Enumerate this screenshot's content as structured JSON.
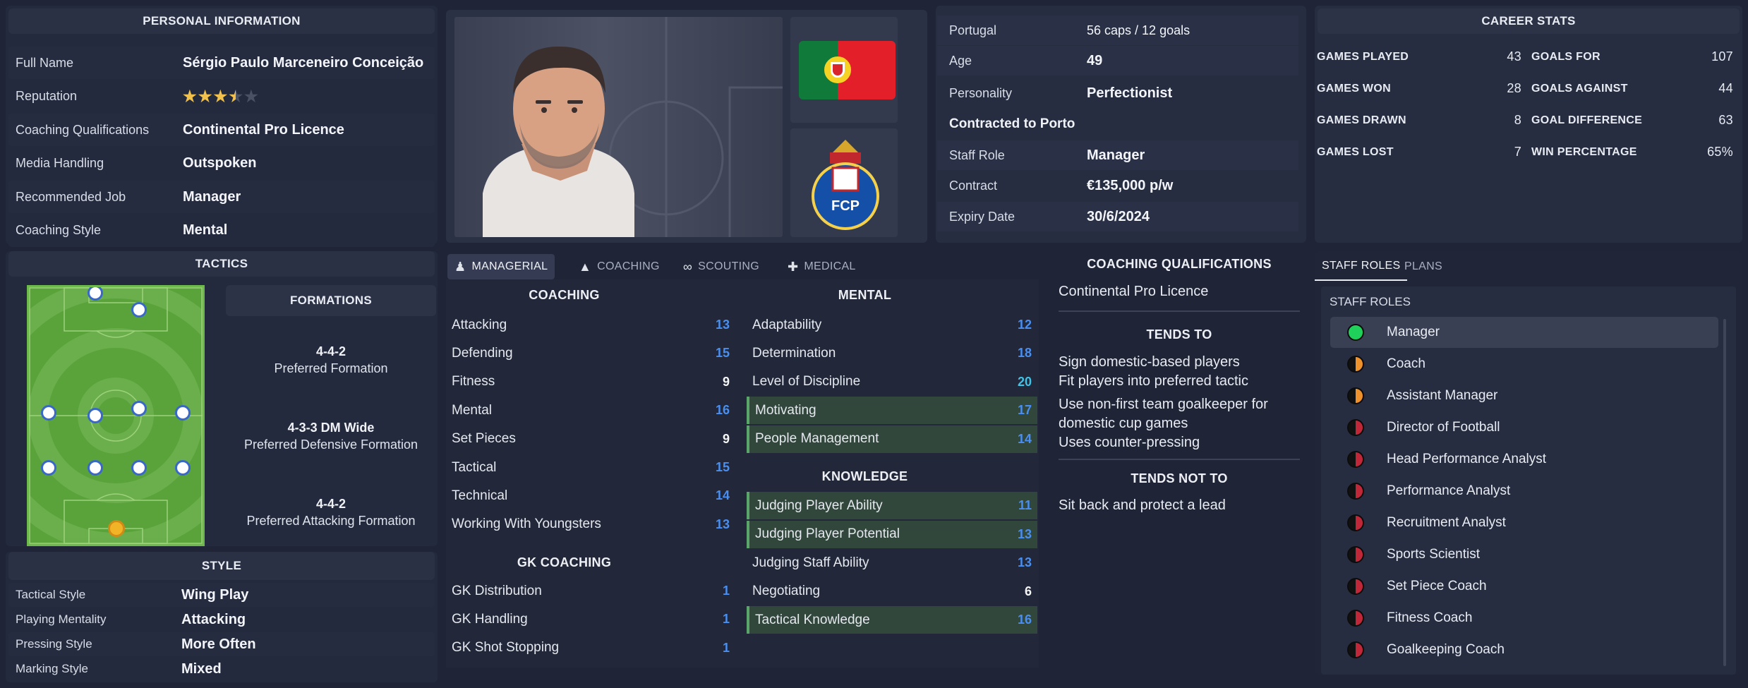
{
  "personal": {
    "header": "PERSONAL INFORMATION",
    "rows": [
      {
        "label": "Full Name",
        "value": "Sérgio Paulo Marceneiro Conceição"
      },
      {
        "label": "Reputation",
        "value": ""
      },
      {
        "label": "Coaching Qualifications",
        "value": "Continental Pro Licence"
      },
      {
        "label": "Media Handling",
        "value": "Outspoken"
      },
      {
        "label": "Recommended Job",
        "value": "Manager"
      },
      {
        "label": "Coaching Style",
        "value": "Mental"
      }
    ],
    "reputation_stars": 3.5,
    "reputation_max": 5
  },
  "contract": {
    "nation": "Portugal",
    "caps": "56 caps / 12 goals",
    "rows": [
      {
        "label": "Age",
        "value": "49"
      },
      {
        "label": "Personality",
        "value": "Perfectionist"
      }
    ],
    "contracted_to": "Contracted to Porto",
    "rows2": [
      {
        "label": "Staff Role",
        "value": "Manager"
      },
      {
        "label": "Contract",
        "value": "€135,000 p/w"
      },
      {
        "label": "Expiry Date",
        "value": "30/6/2024"
      }
    ],
    "club_crest_letters": "FCP"
  },
  "career": {
    "header": "CAREER STATS",
    "left": [
      {
        "label": "GAMES PLAYED",
        "value": "43"
      },
      {
        "label": "GAMES WON",
        "value": "28"
      },
      {
        "label": "GAMES DRAWN",
        "value": "8"
      },
      {
        "label": "GAMES LOST",
        "value": "7"
      }
    ],
    "right": [
      {
        "label": "GOALS FOR",
        "value": "107"
      },
      {
        "label": "GOALS AGAINST",
        "value": "44"
      },
      {
        "label": "GOAL DIFFERENCE",
        "value": "63"
      },
      {
        "label": "WIN PERCENTAGE",
        "value": "65%"
      }
    ]
  },
  "tactics": {
    "header": "TACTICS",
    "formations_header": "FORMATIONS",
    "formations": [
      {
        "name": "4-4-2",
        "desc": "Preferred Formation"
      },
      {
        "name": "4-3-3 DM Wide",
        "desc": "Preferred Defensive Formation"
      },
      {
        "name": "4-4-2",
        "desc": "Preferred Attacking Formation"
      }
    ]
  },
  "style": {
    "header": "STYLE",
    "rows": [
      {
        "label": "Tactical Style",
        "value": "Wing Play"
      },
      {
        "label": "Playing Mentality",
        "value": "Attacking"
      },
      {
        "label": "Pressing Style",
        "value": "More Often"
      },
      {
        "label": "Marking Style",
        "value": "Mixed"
      }
    ]
  },
  "tabs": [
    {
      "label": "MANAGERIAL",
      "icon": "manager-icon"
    },
    {
      "label": "COACHING",
      "icon": "cone-icon"
    },
    {
      "label": "SCOUTING",
      "icon": "binoculars-icon"
    },
    {
      "label": "MEDICAL",
      "icon": "medical-kit-icon"
    }
  ],
  "attributes": {
    "coaching_title": "COACHING",
    "coaching": [
      {
        "name": "Attacking",
        "value": "13"
      },
      {
        "name": "Defending",
        "value": "15"
      },
      {
        "name": "Fitness",
        "value": "9"
      },
      {
        "name": "Mental",
        "value": "16"
      },
      {
        "name": "Set Pieces",
        "value": "9"
      },
      {
        "name": "Tactical",
        "value": "15"
      },
      {
        "name": "Technical",
        "value": "14"
      },
      {
        "name": "Working With Youngsters",
        "value": "13"
      }
    ],
    "gk_title": "GK COACHING",
    "gk": [
      {
        "name": "GK Distribution",
        "value": "1"
      },
      {
        "name": "GK Handling",
        "value": "1"
      },
      {
        "name": "GK Shot Stopping",
        "value": "1"
      }
    ],
    "mental_title": "MENTAL",
    "mental": [
      {
        "name": "Adaptability",
        "value": "12"
      },
      {
        "name": "Determination",
        "value": "18"
      },
      {
        "name": "Level of Discipline",
        "value": "20"
      },
      {
        "name": "Motivating",
        "value": "17"
      },
      {
        "name": "People Management",
        "value": "14"
      }
    ],
    "knowledge_title": "KNOWLEDGE",
    "knowledge": [
      {
        "name": "Judging Player Ability",
        "value": "11"
      },
      {
        "name": "Judging Player Potential",
        "value": "13"
      },
      {
        "name": "Judging Staff Ability",
        "value": "13"
      },
      {
        "name": "Negotiating",
        "value": "6"
      },
      {
        "name": "Tactical Knowledge",
        "value": "16"
      }
    ]
  },
  "qualifications": {
    "title": "COACHING QUALIFICATIONS",
    "value": "Continental Pro Licence",
    "tends_to_title": "TENDS TO",
    "tends_to": [
      "Sign domestic-based players",
      "Fit players into preferred tactic",
      "Use non-first team goalkeeper for domestic cup games",
      "Uses counter-pressing"
    ],
    "tends_not_to_title": "TENDS NOT TO",
    "tends_not_to": [
      "Sit back and protect a lead"
    ]
  },
  "staff_roles": {
    "tabs": [
      "STAFF ROLES",
      "PLANS"
    ],
    "title": "STAFF ROLES",
    "roles": [
      {
        "label": "Manager",
        "status": "green"
      },
      {
        "label": "Coach",
        "status": "orange"
      },
      {
        "label": "Assistant Manager",
        "status": "orange"
      },
      {
        "label": "Director of Football",
        "status": "red"
      },
      {
        "label": "Head Performance Analyst",
        "status": "red"
      },
      {
        "label": "Performance Analyst",
        "status": "red"
      },
      {
        "label": "Recruitment Analyst",
        "status": "red"
      },
      {
        "label": "Sports Scientist",
        "status": "red"
      },
      {
        "label": "Set Piece Coach",
        "status": "red"
      },
      {
        "label": "Fitness Coach",
        "status": "red"
      },
      {
        "label": "Goalkeeping Coach",
        "status": "red"
      }
    ]
  },
  "colors": {
    "attr_blue": "#4a8ff0",
    "attr_white": "#f5f5f5",
    "attr_cyan": "#3fc3e6",
    "highlight_green": "#5aa66a",
    "status_green": "#1fd15a",
    "status_orange": "#f0922b",
    "status_red": "#c0283a"
  }
}
